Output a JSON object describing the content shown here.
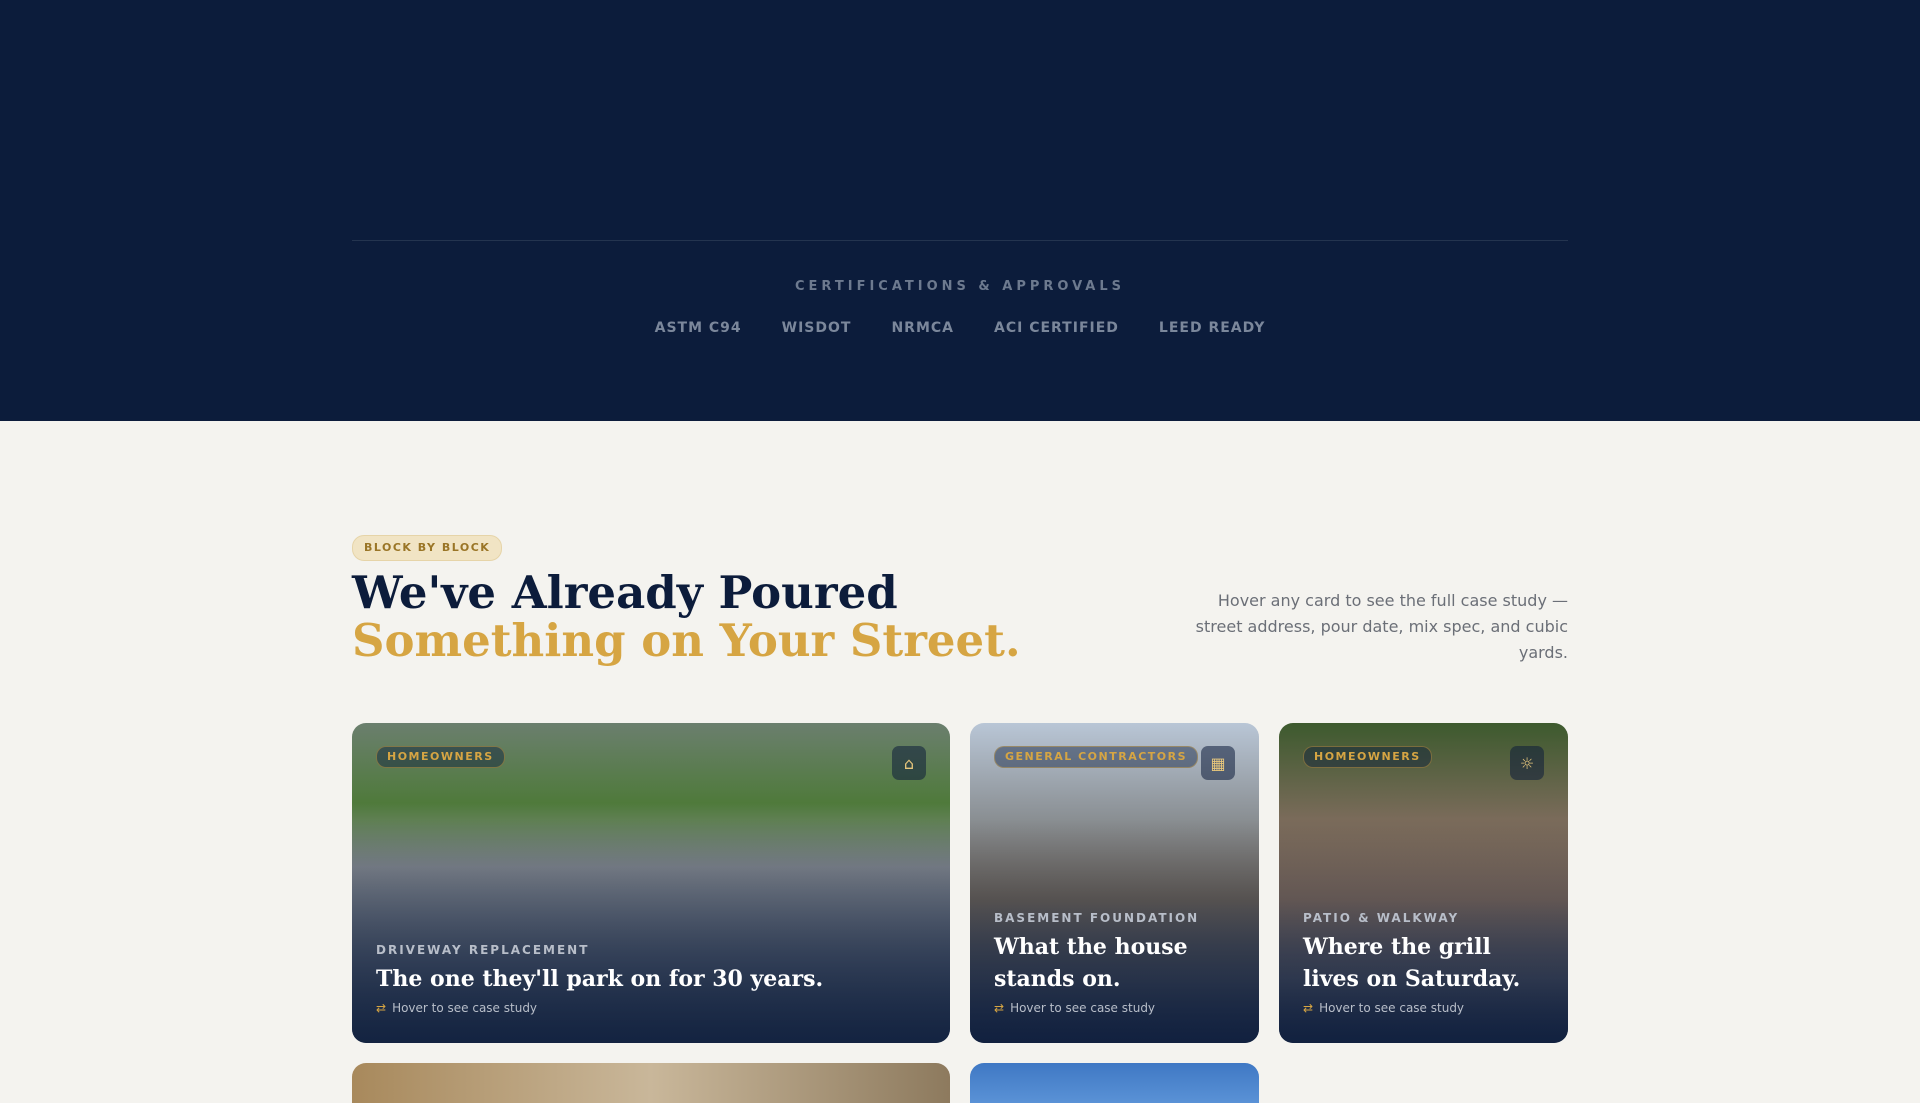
{
  "certifications": {
    "title": "CERTIFICATIONS & APPROVALS",
    "items": [
      "ASTM C94",
      "WISDOT",
      "NRMCA",
      "ACI CERTIFIED",
      "LEED READY"
    ]
  },
  "section": {
    "badge": "BLOCK BY BLOCK",
    "heading_line1": "We've Already Poured",
    "heading_line2": "Something on Your Street.",
    "lede": "Hover any card to see the full case study — street address, pour date, mix spec, and cubic yards."
  },
  "cards": [
    {
      "audience": "HOMEOWNERS",
      "icon": "house-icon",
      "kicker": "DRIVEWAY REPLACEMENT",
      "title": "The one they'll park on for 30 years.",
      "hint": "Hover to see case study"
    },
    {
      "audience": "GENERAL CONTRACTORS",
      "icon": "building-icon",
      "kicker": "BASEMENT FOUNDATION",
      "title": "What the house stands on.",
      "hint": "Hover to see case study"
    },
    {
      "audience": "HOMEOWNERS",
      "icon": "sun-icon",
      "kicker": "PATIO & WALKWAY",
      "title": "Where the grill lives on Saturday.",
      "hint": "Hover to see case study"
    }
  ],
  "colors": {
    "navy": "#0c1c3b",
    "gold": "#d6a543",
    "background": "#f4f3ef"
  }
}
